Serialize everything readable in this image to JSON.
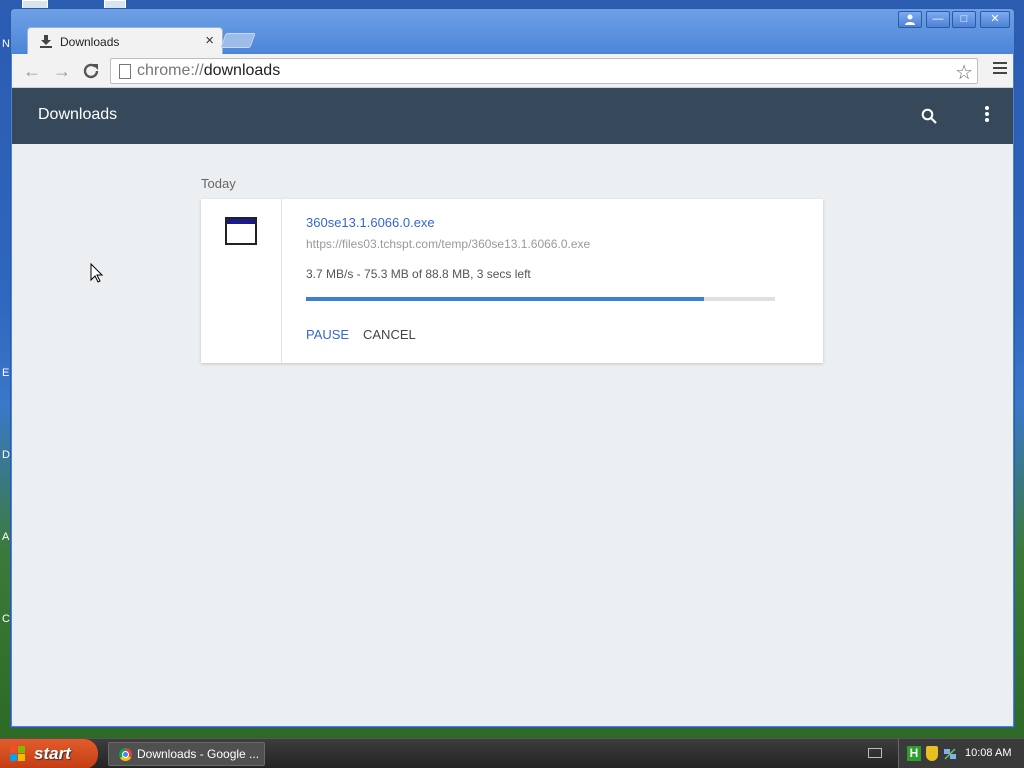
{
  "desktop": {
    "edge_letters": [
      "N",
      "E",
      "D",
      "A",
      "C"
    ]
  },
  "window": {
    "tab_title": "Downloads",
    "controls": {
      "minimize": "—",
      "maximize": "□",
      "close": "✕"
    }
  },
  "toolbar": {
    "url_scheme": "chrome://",
    "url_host": "downloads"
  },
  "downloads_page": {
    "title": "Downloads",
    "date_heading": "Today",
    "item": {
      "file_name": "360se13.1.6066.0.exe",
      "source_url": "https://files03.tchspt.com/temp/360se13.1.6066.0.exe",
      "status": "3.7 MB/s - 75.3 MB of 88.8 MB, 3 secs left",
      "progress_percent": 84.8,
      "pause_label": "PAUSE",
      "cancel_label": "CANCEL"
    }
  },
  "taskbar": {
    "start_label": "start",
    "task_label": "Downloads - Google ...",
    "tray_h": "H",
    "clock": "10:08 AM"
  },
  "colors": {
    "header_bg": "#36495a",
    "link_blue": "#3367d6",
    "progress_fill": "#3d7fd6"
  }
}
